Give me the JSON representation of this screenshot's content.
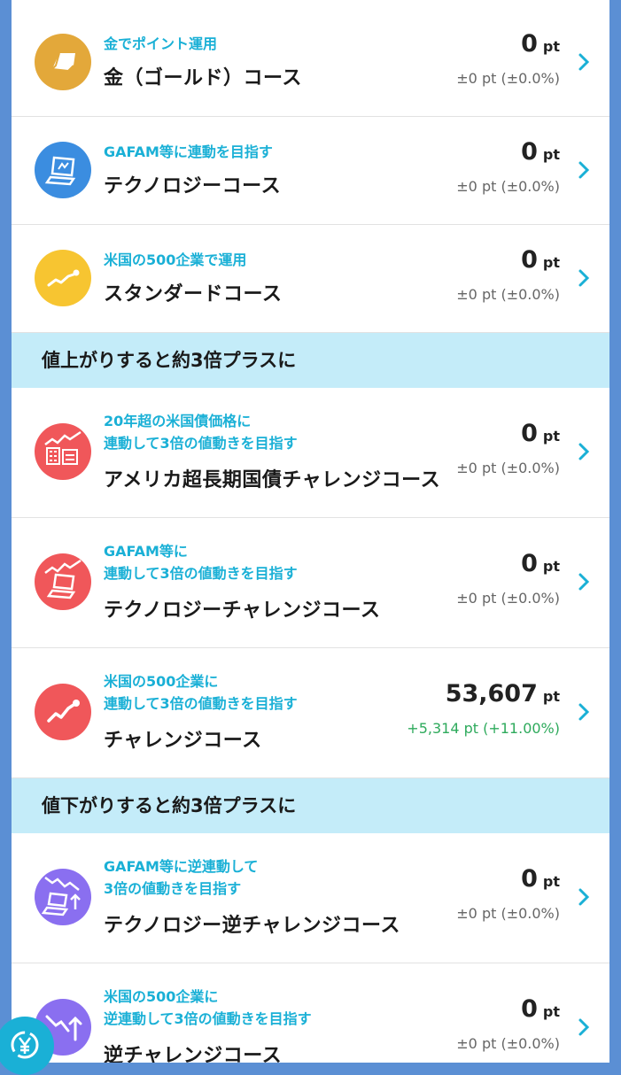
{
  "rows": [
    {
      "sub": "金でポイント運用",
      "title": "金（ゴールド）コース",
      "value": "0",
      "unit": "pt",
      "delta": "±0 pt (±0.0%)",
      "icon": "gold-bar-icon",
      "color": "#e3a83a"
    },
    {
      "sub": "GAFAM等に連動を目指す",
      "title": "テクノロジーコース",
      "value": "0",
      "unit": "pt",
      "delta": "±0 pt (±0.0%)",
      "icon": "laptop-icon",
      "color": "#3b8de0"
    },
    {
      "sub": "米国の500企業で運用",
      "title": "スタンダードコース",
      "value": "0",
      "unit": "pt",
      "delta": "±0 pt (±0.0%)",
      "icon": "trend-line-icon",
      "color": "#f7c531"
    },
    {
      "sub1": "20年超の米国債価格に",
      "sub2": "連動して3倍の値動きを目指す",
      "title": "アメリカ超長期国債チャレンジコース",
      "value": "0",
      "unit": "pt",
      "delta": "±0 pt (±0.0%)",
      "icon": "bond-chart-icon",
      "color": "#f0575a"
    },
    {
      "sub1": "GAFAM等に",
      "sub2": "連動して3倍の値動きを目指す",
      "title": "テクノロジーチャレンジコース",
      "value": "0",
      "unit": "pt",
      "delta": "±0 pt (±0.0%)",
      "icon": "laptop-chart-icon",
      "color": "#f0575a"
    },
    {
      "sub1": "米国の500企業に",
      "sub2": "連動して3倍の値動きを目指す",
      "title": "チャレンジコース",
      "value": "53,607",
      "unit": "pt",
      "delta": "+5,314 pt (+11.00%)",
      "icon": "trend-line-icon",
      "color": "#f0575a"
    },
    {
      "sub1": "GAFAM等に逆連動して",
      "sub2": "3倍の値動きを目指す",
      "title": "テクノロジー逆チャレンジコース",
      "value": "0",
      "unit": "pt",
      "delta": "±0 pt (±0.0%)",
      "icon": "laptop-inverse-icon",
      "color": "#8a6ff0"
    },
    {
      "sub1": "米国の500企業に",
      "sub2": "逆連動して3倍の値動きを目指す",
      "title": "逆チャレンジコース",
      "value": "0",
      "unit": "pt",
      "delta": "±0 pt (±0.0%)",
      "icon": "inverse-trend-icon",
      "color": "#8a6ff0"
    }
  ],
  "sections": {
    "up": "値上がりすると約3倍プラスに",
    "down": "値下がりすると約3倍プラスに"
  },
  "colors": {
    "accent": "#1ab0d6",
    "section_bg": "#c4ecf9",
    "positive": "#2eaa5c",
    "frame": "#5b8fd4"
  }
}
